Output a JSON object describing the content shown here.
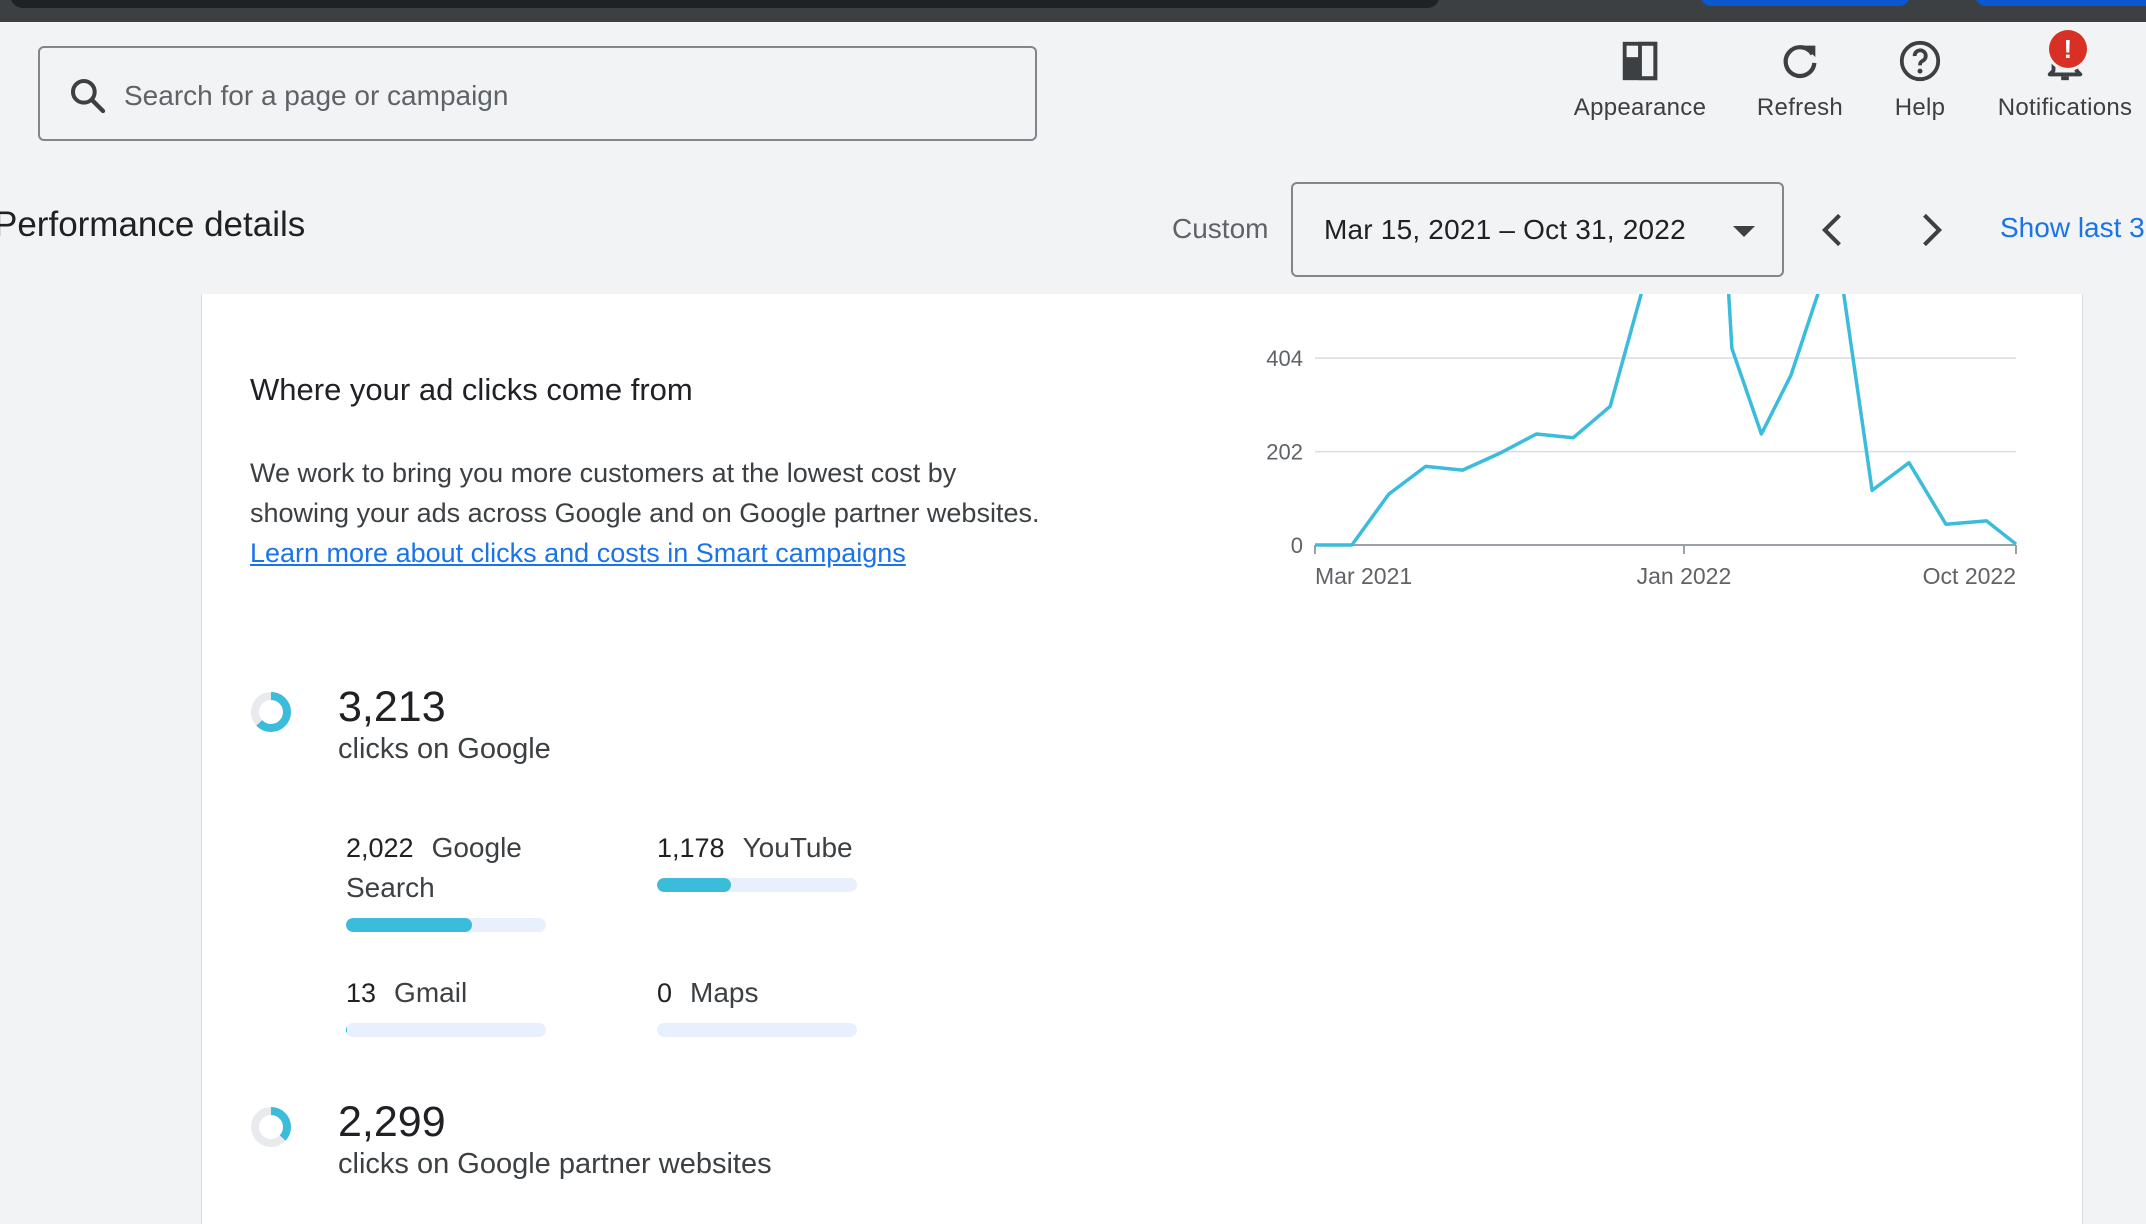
{
  "search": {
    "placeholder": "Search for a page or campaign"
  },
  "toolbar": {
    "appearance": "Appearance",
    "refresh": "Refresh",
    "help": "Help",
    "notifications": "Notifications",
    "notification_badge": "!"
  },
  "header": {
    "title": "Performance details",
    "range_label": "Custom",
    "date_range": "Mar 15, 2021 – Oct 31, 2022",
    "show_last": "Show last 3"
  },
  "clicks_section": {
    "title": "Where your ad clicks come from",
    "description": "We work to bring you more customers at the lowest cost by showing your ads across Google and on Google partner websites.",
    "link_text": "Learn more about clicks and costs in Smart campaigns",
    "google": {
      "count": "3,213",
      "label": "clicks on Google",
      "ring_fraction": 0.63,
      "channels": [
        {
          "count": "2,022",
          "name": "Google Search",
          "fraction": 0.63
        },
        {
          "count": "1,178",
          "name": "YouTube",
          "fraction": 0.37
        },
        {
          "count": "13",
          "name": "Gmail",
          "fraction": 0.004
        },
        {
          "count": "0",
          "name": "Maps",
          "fraction": 0
        }
      ]
    },
    "partners": {
      "count": "2,299",
      "label": "clicks on Google partner websites",
      "ring_fraction": 0.37
    }
  },
  "colors": {
    "accent": "#3bbcda",
    "link": "#1a73e8",
    "badge": "#d93025"
  },
  "chart_data": {
    "type": "line",
    "ylim": [
      0,
      560
    ],
    "yticks": [
      0,
      202,
      404
    ],
    "xticks": [
      {
        "label": "Mar 2021",
        "month": 0
      },
      {
        "label": "Jan 2022",
        "month": 10
      },
      {
        "label": "Oct 2022",
        "month": 19
      }
    ],
    "series": [
      {
        "points": [
          [
            0,
            0
          ],
          [
            1,
            0
          ],
          [
            2,
            110
          ],
          [
            3,
            170
          ],
          [
            4,
            162
          ],
          [
            5,
            198
          ],
          [
            6,
            240
          ],
          [
            7,
            232
          ],
          [
            8,
            300
          ],
          [
            8.9,
            560
          ],
          [
            11.2,
            560
          ],
          [
            11.3,
            425
          ],
          [
            12.1,
            240
          ],
          [
            12.9,
            367
          ],
          [
            13.7,
            560
          ],
          [
            14.3,
            560
          ],
          [
            15.1,
            118
          ],
          [
            16.1,
            178
          ],
          [
            17.1,
            45
          ],
          [
            18.2,
            52
          ],
          [
            19,
            2
          ]
        ]
      }
    ]
  }
}
